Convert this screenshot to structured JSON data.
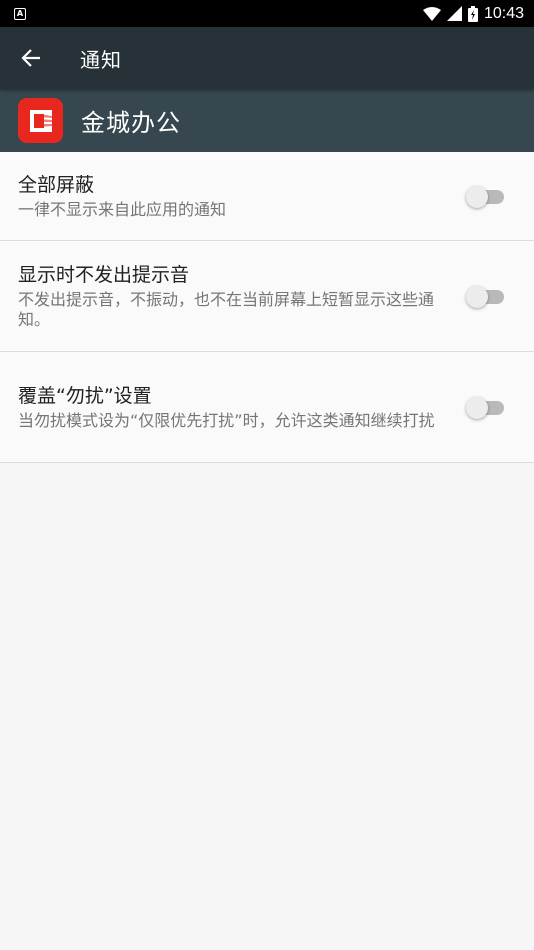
{
  "status_bar": {
    "time": "10:43",
    "icons": [
      "a-notification-icon",
      "wifi-icon",
      "signal-icon",
      "battery-charging-icon"
    ]
  },
  "app_bar": {
    "title": "通知",
    "back_icon": "back-arrow-icon"
  },
  "app_header": {
    "name": "金城办公",
    "logo_color": "#e8281e"
  },
  "settings": [
    {
      "title": "全部屏蔽",
      "summary": "一律不显示来自此应用的通知",
      "enabled": false
    },
    {
      "title": "显示时不发出提示音",
      "summary": "不发出提示音，不振动，也不在当前屏幕上短暂显示这些通知。",
      "enabled": false
    },
    {
      "title": "覆盖“勿扰”设置",
      "summary": "当勿扰模式设为“仅限优先打扰”时，允许这类通知继续打扰",
      "enabled": false
    }
  ],
  "colors": {
    "app_bar": "#263238",
    "app_header": "#37474f",
    "background": "#fafafa"
  }
}
